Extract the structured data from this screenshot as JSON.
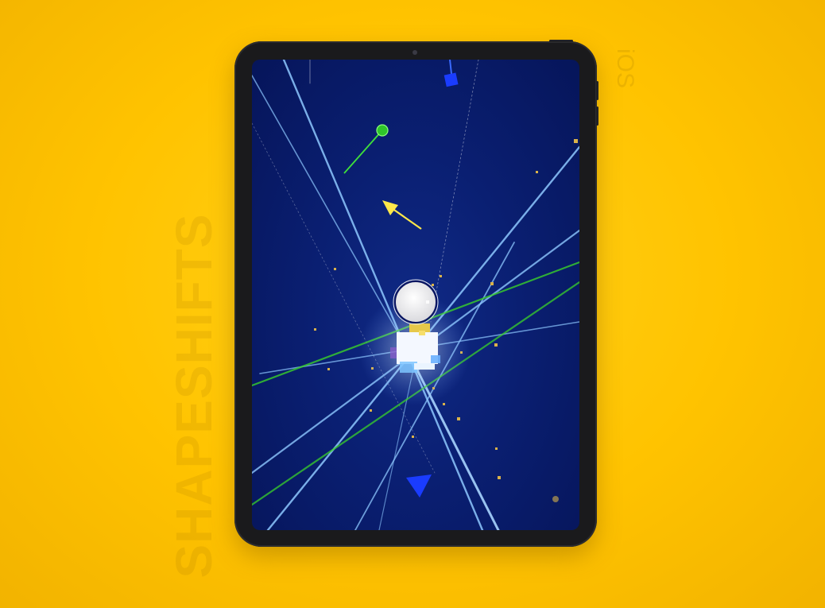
{
  "side_text": "SHAPESHIFTS",
  "platform_text": "iOS",
  "icons": {
    "green_dot": "green-circle-target-icon",
    "blue_square": "blue-square-enemy-icon",
    "blue_triangle": "blue-triangle-enemy-icon",
    "yellow_arrow": "direction-arrow-icon",
    "white_circle": "player-circle-icon"
  },
  "colors": {
    "background": "#ffc300",
    "screen": "#0a1f72",
    "beam": "#8ec8ff",
    "green_beam": "#39d12a",
    "arrow": "#ffe84a",
    "target": "#3fe13a",
    "enemy": "#1a3cff",
    "sparkle": "#d9b24a"
  }
}
